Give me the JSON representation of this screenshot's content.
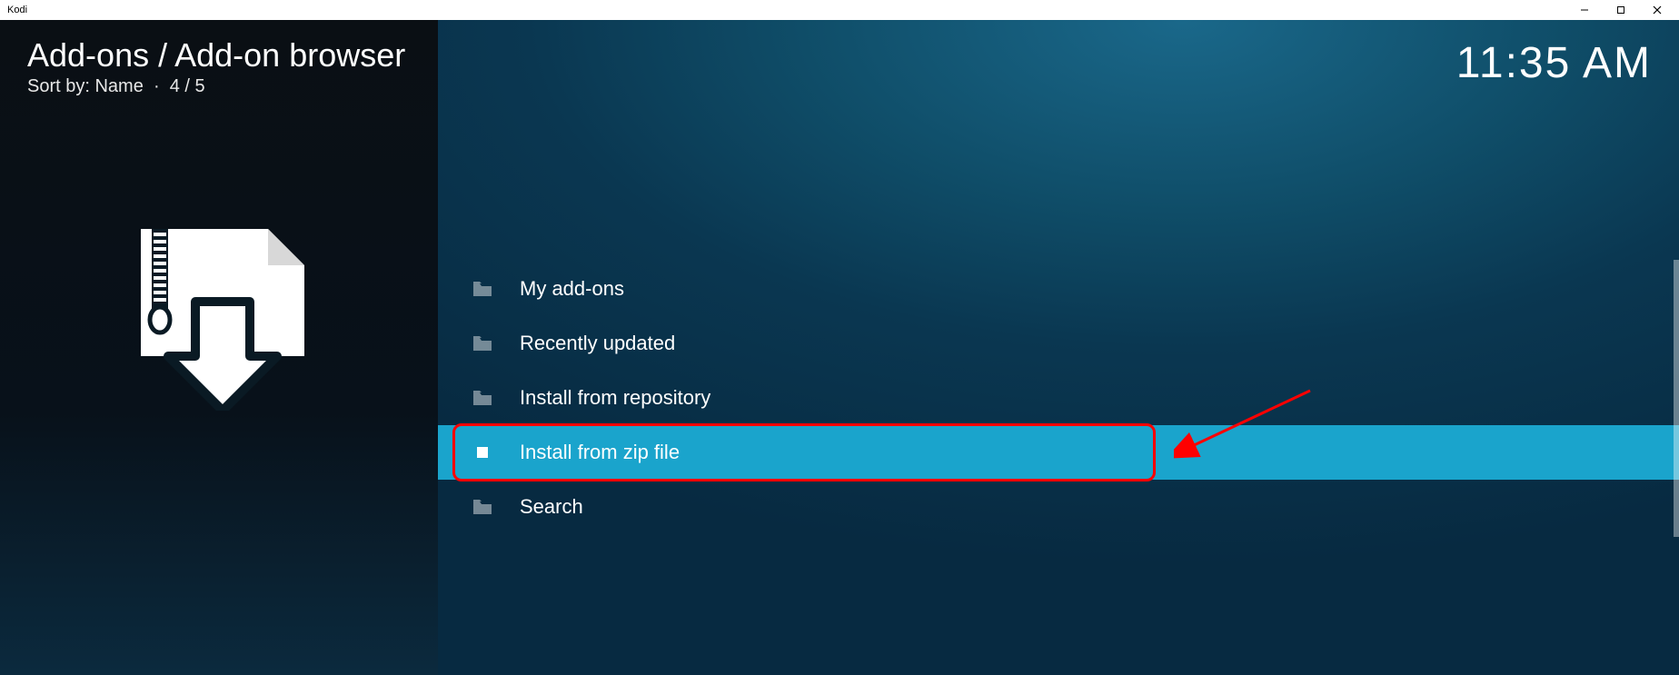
{
  "window": {
    "title": "Kodi"
  },
  "header": {
    "breadcrumb": "Add-ons / Add-on browser",
    "sort_label": "Sort by: Name",
    "position": "4 / 5",
    "clock": "11:35 AM"
  },
  "menu": {
    "items": [
      {
        "label": "My add-ons",
        "icon": "folder",
        "selected": false
      },
      {
        "label": "Recently updated",
        "icon": "folder",
        "selected": false
      },
      {
        "label": "Install from repository",
        "icon": "folder",
        "selected": false
      },
      {
        "label": "Install from zip file",
        "icon": "file",
        "selected": true
      },
      {
        "label": "Search",
        "icon": "folder",
        "selected": false
      }
    ]
  },
  "annotation": {
    "highlight_target": "Install from zip file"
  }
}
